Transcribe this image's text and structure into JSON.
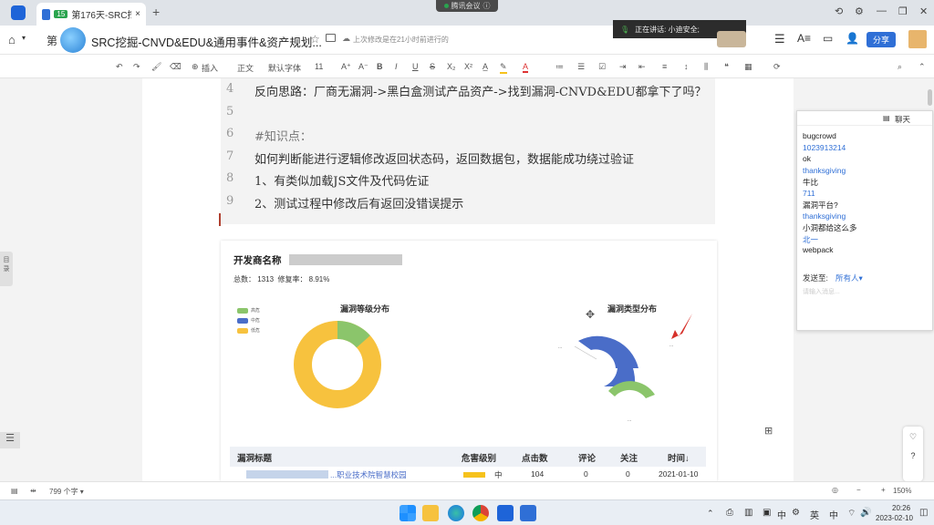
{
  "tab": {
    "title": "第176天-SRC挖掘-CNVD...",
    "badge": "15"
  },
  "meeting": {
    "label": "腾讯会议"
  },
  "doc": {
    "title": "SRC挖掘-CNVD&EDU&通用事件&资产规划...",
    "prefix": "第",
    "saved": "上次修改是在21小时前进行的",
    "share": "分享"
  },
  "speaking": {
    "label": "正在讲话: 小迪安全;"
  },
  "toolbar": {
    "insert": "插入",
    "style": "正文",
    "font": "默认字体",
    "size": "11"
  },
  "code_lines": [
    {
      "n": "4",
      "text": "反向思路：厂商无漏洞->黑白盒测试产品资产->找到漏洞-CNVD&EDU都拿下了吗？"
    },
    {
      "n": "5",
      "text": ""
    },
    {
      "n": "6",
      "text": "#知识点："
    },
    {
      "n": "7",
      "text": "如何判断能进行逻辑修改返回状态码，返回数据包，数据能成功绕过验证"
    },
    {
      "n": "8",
      "text": "1、有类似加载JS文件及代码佐证"
    },
    {
      "n": "9",
      "text": "2、测试过程中修改后有返回没错误提示"
    }
  ],
  "report": {
    "dev_label": "开发商名称",
    "stats": "总数： 1313  修复率： 8.91%",
    "pie1_title": "漏洞等级分布",
    "pie2_title": "漏洞类型分布",
    "legend": [
      {
        "label": "高危",
        "color": "#8bc56b"
      },
      {
        "label": "中危",
        "color": "#4a6dc8"
      },
      {
        "label": "低危",
        "color": "#f7c23e"
      }
    ],
    "pie2_labels": [
      "...",
      "...",
      "..."
    ],
    "table_headers": [
      "漏洞标题",
      "危害级别",
      "点击数",
      "评论",
      "关注",
      "时间↓"
    ],
    "row": {
      "title": "...职业技术院智慧校园",
      "level": "中",
      "clicks": "104",
      "comments": "0",
      "follow": "0",
      "date": "2021-01-10"
    }
  },
  "chat": {
    "title": "聊天",
    "messages": [
      {
        "text": "bugcrowd",
        "color": "#222"
      },
      {
        "text": "1023913214",
        "color": "#2f6fd6"
      },
      {
        "text": "ok",
        "color": "#222"
      },
      {
        "text": "thanksgiving",
        "color": "#2f6fd6"
      },
      {
        "text": "牛比",
        "color": "#222"
      },
      {
        "text": "711",
        "color": "#2f6fd6"
      },
      {
        "text": "漏洞平台?",
        "color": "#222"
      },
      {
        "text": "thanksgiving",
        "color": "#2f6fd6"
      },
      {
        "text": "小洞都给这么多",
        "color": "#222"
      },
      {
        "text": "北一",
        "color": "#2f6fd6"
      },
      {
        "text": "webpack",
        "color": "#222"
      }
    ],
    "send_to_label": "发送至:",
    "send_to_value": "所有人▾",
    "input_placeholder": "请输入消息..."
  },
  "status": {
    "word_count": "799 个字 ▾",
    "zoom": "150%"
  },
  "clock": {
    "time": "20:26",
    "date": "2023-02-10"
  }
}
